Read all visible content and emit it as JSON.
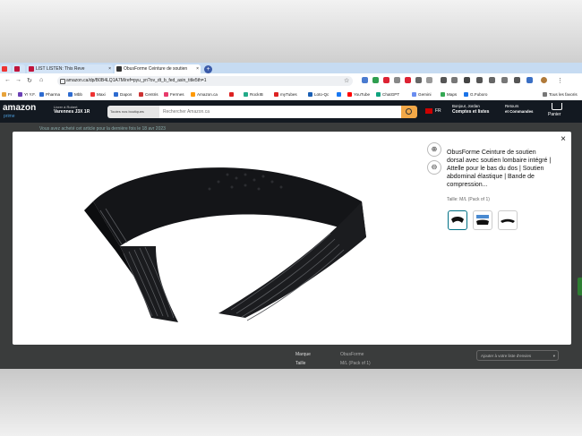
{
  "tabs": [
    {
      "label": "",
      "color": "#e33"
    },
    {
      "label": "LIST LISTEN: This Reve",
      "color": "#c0143c"
    },
    {
      "label": "ObusForme Ceinture de soutien",
      "color": "#555"
    }
  ],
  "address_bar": {
    "url": "amazon.ca/dp/B0B4LQ1A7M/ref=pyu_yn?ov_dt_b_fed_asin_title5th=1"
  },
  "bookmarks": [
    "Fr",
    "Y! Y.F.",
    "Pharma",
    "Mbb",
    "Maxi",
    "Dapos",
    "Centris",
    "Fermes",
    "Amazon.ca",
    "",
    "RockIB",
    "myTubes",
    "Loto-Qc",
    "",
    "YouTube",
    "ChatGPT",
    "Gemini",
    "Maps",
    "G.Fuboro",
    "Tous les favoris"
  ],
  "amazon": {
    "logo": "amazon",
    "logo_sub": "prime",
    "deliver_line1": "Livrer à Robert",
    "deliver_line2": "Varennes J3X 1R",
    "category": "Toutes nos boutiques",
    "search_placeholder": "Rechercher Amazon.ca",
    "lang": "FR",
    "account_line1": "Bonjour, Jordan",
    "account_line2": "Comptes et listes",
    "returns_line1": "Retours",
    "returns_line2": "et Commandes",
    "cart_label": "Panier"
  },
  "behind": {
    "purchase_notice": "Vous avez acheté cet article pour la dernière fois le 18 avr 2023",
    "add_to_list": "Ajouter à votre liste d'envies",
    "spec_rows": [
      {
        "name": "Marque",
        "value": "ObusForme"
      },
      {
        "name": "Taille",
        "value": "M/L (Pack of 1)"
      }
    ]
  },
  "modal": {
    "title": "ObusForme Ceinture de soutien dorsal avec soutien lombaire intégré | Attelle pour le bas du dos | Soutien abdominal élastique | Bande de compression...",
    "variant": "Taille: M/L (Pack of 1)",
    "zoom_in_icon": "zoom-in-icon",
    "zoom_out_icon": "zoom-out-icon",
    "close_glyph": "×",
    "thumbnails": [
      "belt-side-view",
      "belt-with-diagram",
      "belt-flat-view"
    ]
  },
  "colors": {
    "amazon_nav": "#131921",
    "search_button": "#f3a847",
    "selected_thumb": "#007185",
    "belt": "#16171a"
  }
}
